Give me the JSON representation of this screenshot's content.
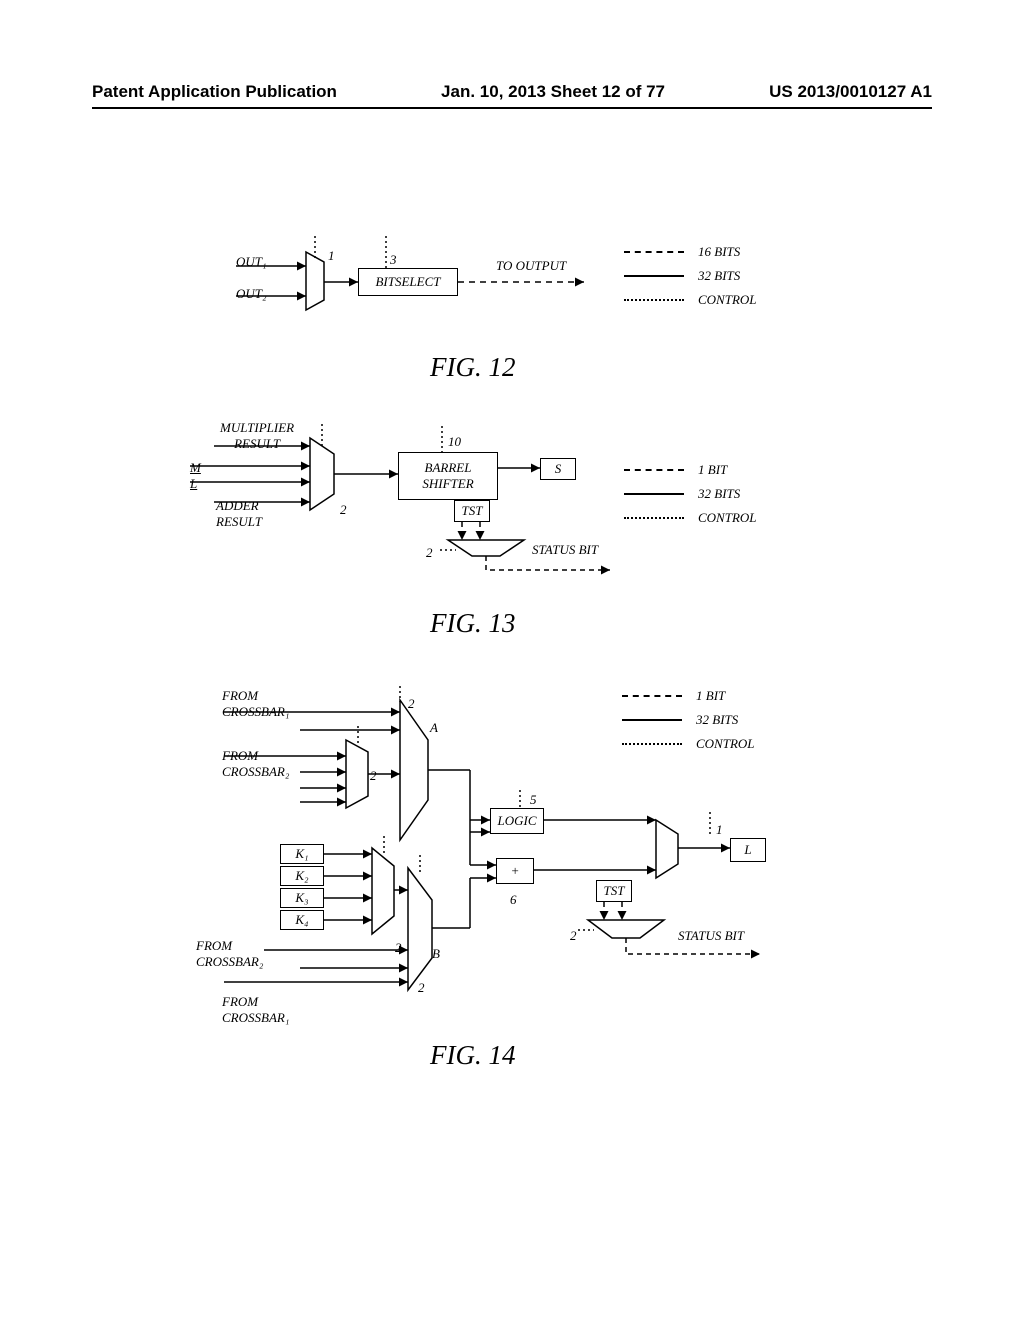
{
  "header": {
    "left": "Patent Application Publication",
    "center": "Jan. 10, 2013  Sheet 12 of 77",
    "right": "US 2013/0010127 A1"
  },
  "fig12": {
    "out1": "OUT₁",
    "out2": "OUT₂",
    "mux_num": "1",
    "box_num": "3",
    "bitselect": "BITSELECT",
    "to_output": "TO OUTPUT",
    "legend": {
      "l1": "16 BITS",
      "l2": "32 BITS",
      "l3": "CONTROL"
    },
    "caption": "FIG. 12"
  },
  "fig13": {
    "mult": "MULTIPLIER\nRESULT",
    "m": "M",
    "l": "L",
    "adder": "ADDER\nRESULT",
    "mux_num": "2",
    "barrel_num": "10",
    "barrel": "BARREL\nSHIFTER",
    "s": "S",
    "tst": "TST",
    "status_bit": "STATUS BIT",
    "demux_num": "2",
    "legend": {
      "l1": "1 BIT",
      "l2": "32 BITS",
      "l3": "CONTROL"
    },
    "caption": "FIG. 13"
  },
  "fig14": {
    "from_cb1a": "FROM\nCROSSBAR₁",
    "from_cb2a": "FROM\nCROSSBAR₂",
    "from_cb2b": "FROM\nCROSSBAR₂",
    "from_cb1b": "FROM\nCROSSBAR₁",
    "k1": "K₁",
    "k2": "K₂",
    "k3": "K₃",
    "k4": "K₄",
    "mux2_a": "2",
    "mux2_b": "2",
    "mux2_c": "2",
    "mux2_d": "2",
    "labelA": "A",
    "labelB": "B",
    "logic_num": "5",
    "logic": "LOGIC",
    "plus": "+",
    "plus_num": "6",
    "tst": "TST",
    "demux_num": "2",
    "mux_out_num": "1",
    "l_box": "L",
    "status_bit": "STATUS BIT",
    "legend": {
      "l1": "1 BIT",
      "l2": "32 BITS",
      "l3": "CONTROL"
    },
    "caption": "FIG. 14"
  }
}
